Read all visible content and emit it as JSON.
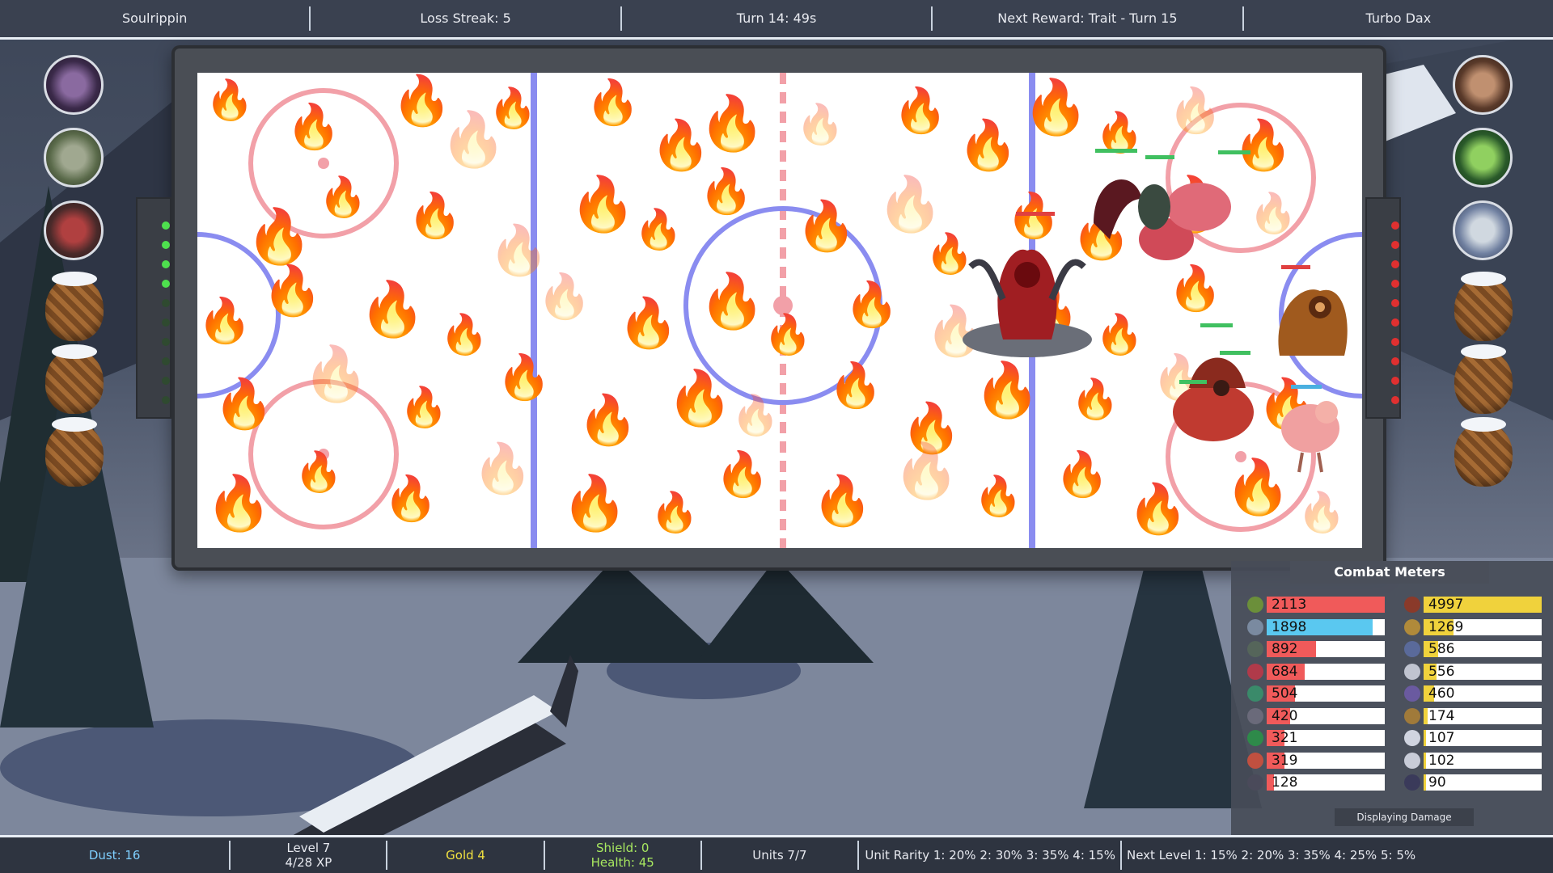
{
  "topbar": {
    "player": "Soulrippin",
    "loss_streak": "Loss Streak: 5",
    "turn": "Turn 14: 49s",
    "next_reward": "Next Reward: Trait - Turn 15",
    "opponent": "Turbo Dax"
  },
  "bottombar": {
    "dust": "Dust: 16",
    "level": "Level 7",
    "xp": "4/28 XP",
    "gold": "Gold 4",
    "shield": "Shield: 0",
    "health": "Health: 45",
    "units": "Units 7/7",
    "rarity": "Unit Rarity 1: 20% 2: 30% 3: 35% 4: 15%",
    "next_level": "Next Level 1: 15% 2: 20% 3: 35% 4: 25% 5: 5%"
  },
  "combat_meters": {
    "title": "Combat Meters",
    "footer": "Displaying Damage",
    "left": [
      {
        "value": "2113",
        "fill": 1.0,
        "color": "#f05a5a",
        "icon": "#6b8f3a"
      },
      {
        "value": "1898",
        "fill": 0.9,
        "color": "#5ac8f0",
        "icon": "#7a8aa0"
      },
      {
        "value": "892",
        "fill": 0.42,
        "color": "#f05a5a",
        "icon": "#55655a"
      },
      {
        "value": "684",
        "fill": 0.32,
        "color": "#f05a5a",
        "icon": "#b03a4a"
      },
      {
        "value": "504",
        "fill": 0.24,
        "color": "#f05a5a",
        "icon": "#3a8a6a"
      },
      {
        "value": "420",
        "fill": 0.2,
        "color": "#f05a5a",
        "icon": "#6a6a7a"
      },
      {
        "value": "321",
        "fill": 0.15,
        "color": "#f05a5a",
        "icon": "#2e8a4a"
      },
      {
        "value": "319",
        "fill": 0.15,
        "color": "#f05a5a",
        "icon": "#c05040"
      },
      {
        "value": "128",
        "fill": 0.06,
        "color": "#f05a5a",
        "icon": "#4a4a5a"
      }
    ],
    "right": [
      {
        "value": "4997",
        "fill": 1.0,
        "color": "#f0d23c",
        "icon": "#8a3a2a"
      },
      {
        "value": "1269",
        "fill": 0.25,
        "color": "#f0d23c",
        "icon": "#b08a3a"
      },
      {
        "value": "586",
        "fill": 0.12,
        "color": "#f0d23c",
        "icon": "#5a6a9a"
      },
      {
        "value": "556",
        "fill": 0.11,
        "color": "#f0d23c",
        "icon": "#c0c4d0"
      },
      {
        "value": "460",
        "fill": 0.09,
        "color": "#f0d23c",
        "icon": "#6a5aa0"
      },
      {
        "value": "174",
        "fill": 0.035,
        "color": "#f0d23c",
        "icon": "#a07a3a"
      },
      {
        "value": "107",
        "fill": 0.02,
        "color": "#f0d23c",
        "icon": "#d0d4e0"
      },
      {
        "value": "102",
        "fill": 0.02,
        "color": "#f0d23c",
        "icon": "#c8ccd8"
      },
      {
        "value": "90",
        "fill": 0.018,
        "color": "#f0d23c",
        "icon": "#3a3a5a"
      }
    ]
  },
  "icons": {
    "flame": "🔥",
    "left_lights": "green-led",
    "right_lights": "red-led"
  },
  "colors": {
    "gold_text": "#f0e040",
    "dust_text": "#7fd0ff",
    "shield_text": "#a8e860"
  }
}
